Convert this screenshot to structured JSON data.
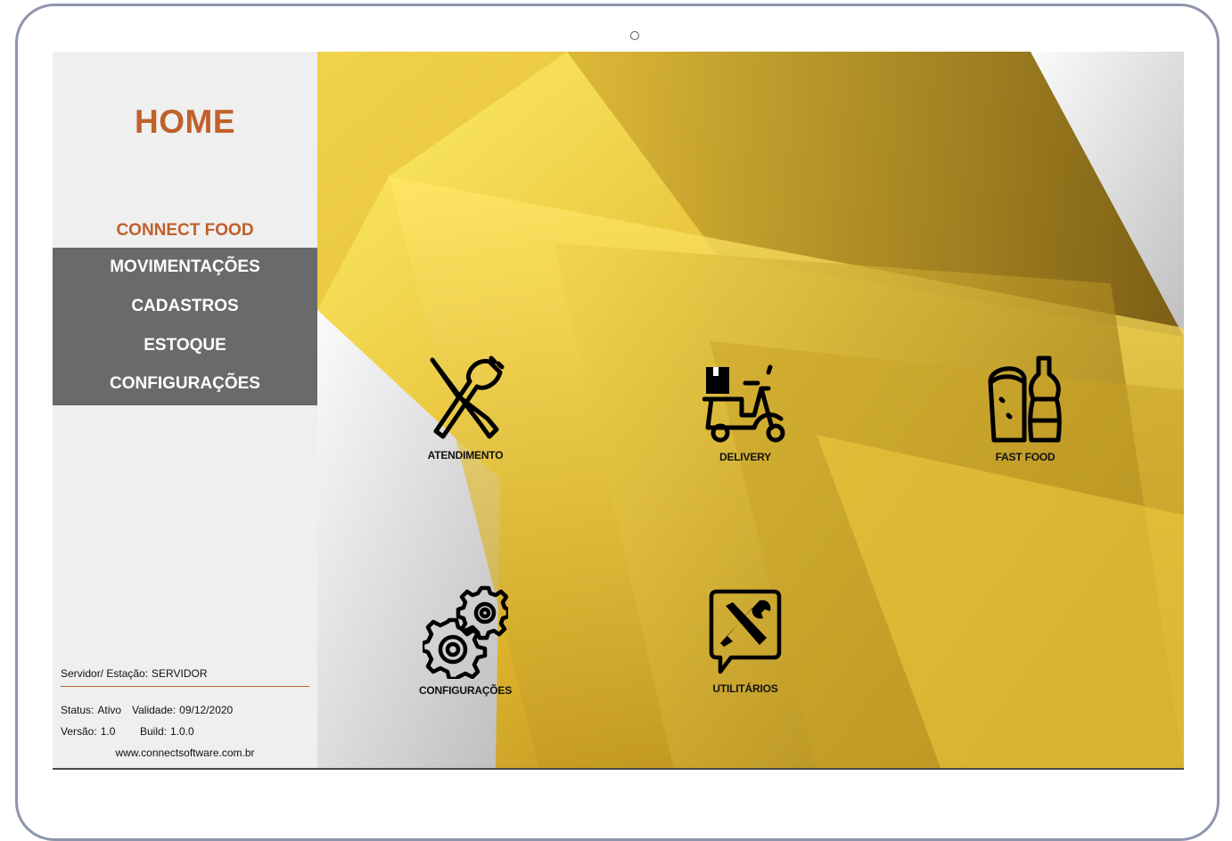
{
  "sidebar": {
    "title": "HOME",
    "brand": "CONNECT FOOD",
    "menu": [
      "MOVIMENTAÇÕES",
      "CADASTROS",
      "ESTOQUE",
      "CONFIGURAÇÕES"
    ],
    "server_label": "Servidor/ Estação:",
    "server_value": "SERVIDOR",
    "status_label": "Status:",
    "status_value": "Ativo",
    "validade_label": "Validade:",
    "validade_value": "09/12/2020",
    "versao_label": "Versão:",
    "versao_value": "1.0",
    "build_label": "Build:",
    "build_value": "1.0.0",
    "website": "www.connectsoftware.com.br"
  },
  "tiles": [
    {
      "label": "ATENDIMENTO",
      "icon": "fork-knife-icon"
    },
    {
      "label": "DELIVERY",
      "icon": "delivery-scooter-icon"
    },
    {
      "label": "FAST FOOD",
      "icon": "burrito-soda-icon"
    },
    {
      "label": "CONFIGURAÇÕES",
      "icon": "gears-icon"
    },
    {
      "label": "UTILITÁRIOS",
      "icon": "tools-chat-icon"
    }
  ],
  "colors": {
    "accent": "#c0602a",
    "menu_bg": "#6a6a6a",
    "sidebar_bg": "#efefef",
    "background_gold": "#e6c43c"
  }
}
